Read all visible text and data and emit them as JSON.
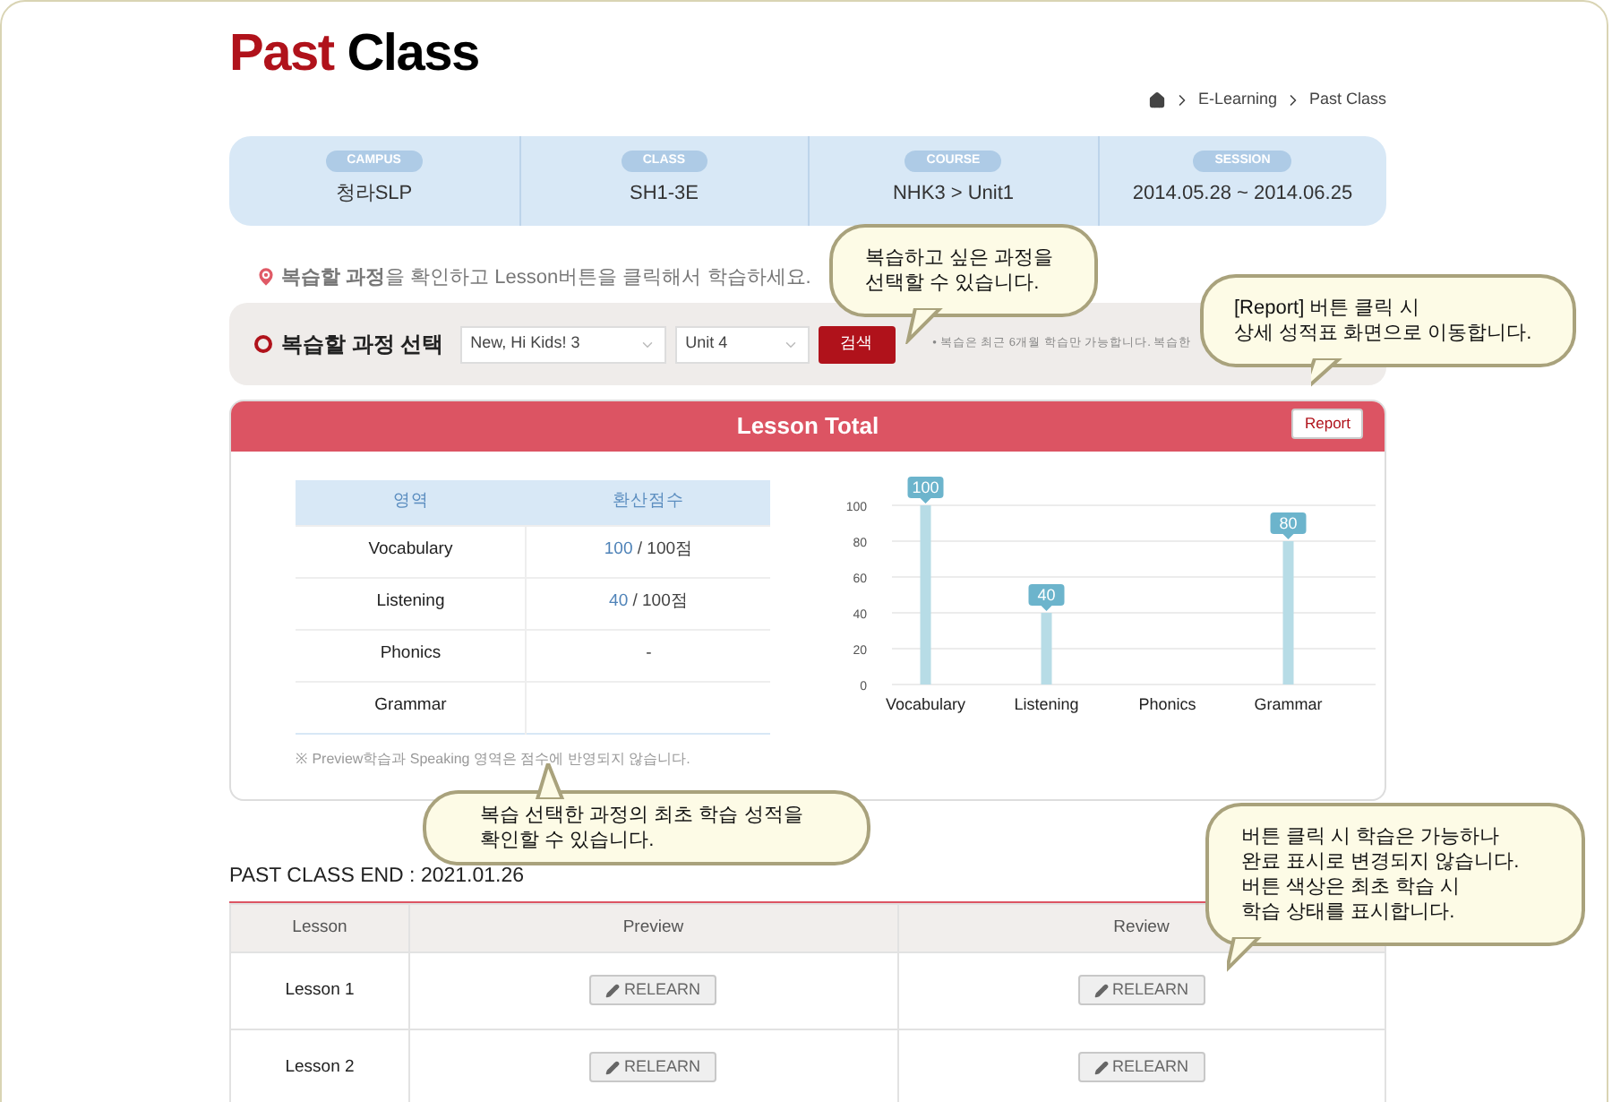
{
  "title": {
    "accent": "Past",
    "rest": "Class"
  },
  "breadcrumb": [
    "E-Learning",
    "Past Class"
  ],
  "info": [
    {
      "label": "CAMPUS",
      "value": "청라SLP"
    },
    {
      "label": "CLASS",
      "value": "SH1-3E"
    },
    {
      "label": "COURSE",
      "value": "NHK3 > Unit1"
    },
    {
      "label": "SESSION",
      "value": "2014.05.28 ~ 2014.06.25"
    }
  ],
  "instruction": "**복습할 과정**을 확인하고 Lesson버튼을 클릭해서 학습하세요.",
  "selector": {
    "label": "복습할 과정 선택",
    "course": "New, Hi Kids! 3",
    "unit": "Unit 4",
    "button": "검색",
    "bullet": "•",
    "notice": "복습은 최근 6개월 학습만 가능합니다. 복습한"
  },
  "lesson_total": {
    "title": "Lesson Total",
    "report": "Report",
    "columns": [
      "영역",
      "환산점수"
    ],
    "rows": [
      {
        "area": "Vocabulary",
        "score": "100",
        "total": " / 100점"
      },
      {
        "area": "Listening",
        "score": "40",
        "total": " / 100점"
      },
      {
        "area": "Phonics",
        "score": "",
        "total": "-"
      },
      {
        "area": "Grammar",
        "score": "",
        "total": ""
      }
    ],
    "footnote": "※ Preview학습과 Speaking 영역은 점수에 반영되지 않습니다.",
    "chart_data": {
      "type": "bar",
      "categories": [
        "Vocabulary",
        "Listening",
        "Phonics",
        "Grammar"
      ],
      "values": [
        100,
        40,
        null,
        80
      ],
      "ylim": [
        0,
        100
      ],
      "yticks": [
        0,
        20,
        40,
        60,
        80,
        100
      ],
      "grid": true,
      "data_labels": true
    }
  },
  "past_class": {
    "title": "PAST CLASS END : 2021.01.26",
    "columns": [
      "Lesson",
      "Preview",
      "Review"
    ],
    "rows": [
      {
        "lesson": "Lesson 1",
        "preview": "RELEARN",
        "review": "RELEARN"
      },
      {
        "lesson": "Lesson 2",
        "preview": "RELEARN",
        "review": "RELEARN"
      }
    ]
  },
  "callouts": [
    {
      "text": "복습하고 싶은 과정을\n선택할 수 있습니다."
    },
    {
      "text": "[Report] 버튼 클릭 시\n상세 성적표 화면으로 이동합니다."
    },
    {
      "text": "복습 선택한 과정의 최초 학습 성적을\n확인할 수 있습니다."
    },
    {
      "text": "버튼 클릭 시 학습은 가능하나\n완료 표시로 변경되지 않습니다.\n버튼 색상은 최초 학습 시\n학습 상태를 표시합니다."
    }
  ]
}
